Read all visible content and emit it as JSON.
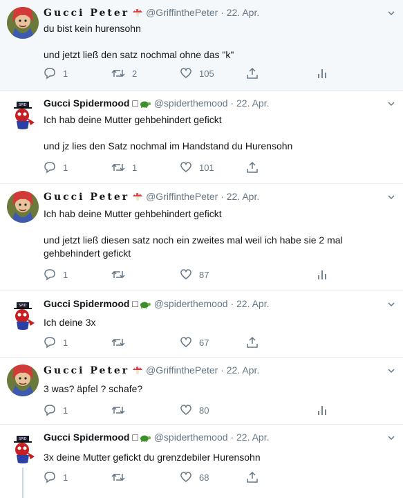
{
  "tweets": [
    {
      "author": "Gucci Peter",
      "handle": "@GriffinthePeter",
      "dot": "·",
      "date": "22. Apr.",
      "lines": [
        "du bist kein hurensohn",
        "und jetzt ließ den satz nochmal ohne das \"k\""
      ],
      "replies": "1",
      "retweets": "2",
      "likes": "105"
    },
    {
      "author": "Gucci Spidermood",
      "author_suffix": "□",
      "handle": "@spiderthemood",
      "dot": "·",
      "date": "22. Apr.",
      "lines": [
        "Ich hab deine Mutter gehbehindert gefickt",
        "und jz lies den Satz nochmal im Handstand du Hurensohn"
      ],
      "replies": "1",
      "retweets": "1",
      "likes": "101"
    },
    {
      "author": "Gucci Peter",
      "handle": "@GriffinthePeter",
      "dot": "·",
      "date": "22. Apr.",
      "lines": [
        "Ich hab deine Mutter gehbehindert gefickt",
        "und jetzt ließ diesen satz noch ein zweites mal weil ich habe sie 2 mal",
        "gehbehindert gefickt"
      ],
      "replies": "1",
      "retweets": "",
      "likes": "87"
    },
    {
      "author": "Gucci Spidermood",
      "author_suffix": "□",
      "handle": "@spiderthemood",
      "dot": "·",
      "date": "22. Apr.",
      "lines": [
        "Ich deine 3x"
      ],
      "replies": "1",
      "retweets": "",
      "likes": "67"
    },
    {
      "author": "Gucci Peter",
      "handle": "@GriffinthePeter",
      "dot": "·",
      "date": "22. Apr.",
      "lines": [
        "3 was? äpfel ? schafe?"
      ],
      "replies": "1",
      "retweets": "",
      "likes": "80"
    },
    {
      "author": "Gucci Spidermood",
      "author_suffix": "□",
      "handle": "@spiderthemood",
      "dot": "·",
      "date": "22. Apr.",
      "lines": [
        "3x deine Mutter gefickt du grenzdebiler Hurensohn"
      ],
      "replies": "1",
      "retweets": "",
      "likes": "68"
    }
  ],
  "colors": {
    "secondary": "#657786",
    "border": "#e6ecf0",
    "highlight": "#f5f8fa",
    "text": "#14171a"
  },
  "icons": [
    "reply-icon",
    "retweet-icon",
    "like-icon",
    "share-icon",
    "analytics-icon",
    "caret-down-icon",
    "mushroom-icon",
    "turtle-icon"
  ]
}
